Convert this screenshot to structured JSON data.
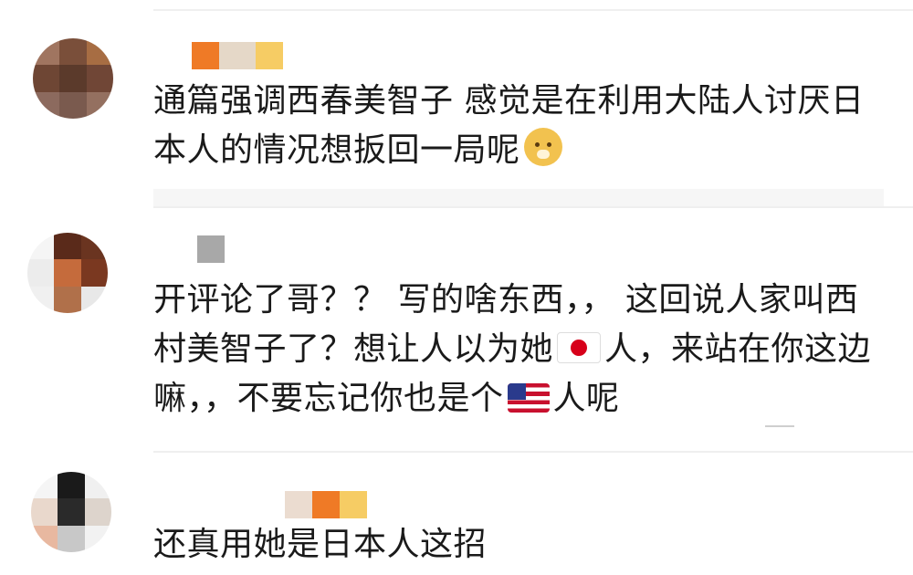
{
  "comments": [
    {
      "text_lines": [
        "通篇强调西春美智子 感觉是在利用大陆人讨厌日",
        "本人的情况想扳回一局呢"
      ],
      "emoji": "doge-icon"
    },
    {
      "text_lines": [
        "开评论了哥？？ 写的啥东西，， 这回说人家叫西",
        "村美智子了？想让人以为她",
        "人，来站在你这边",
        "嘛，，不要忘记你也是个",
        "人呢"
      ],
      "flags": [
        "japan-flag-icon",
        "us-flag-icon"
      ]
    },
    {
      "text_lines": [
        "还真用她是日本人这招"
      ]
    }
  ],
  "colors": {
    "divider": "#efefef",
    "text": "#1a1a1a"
  }
}
